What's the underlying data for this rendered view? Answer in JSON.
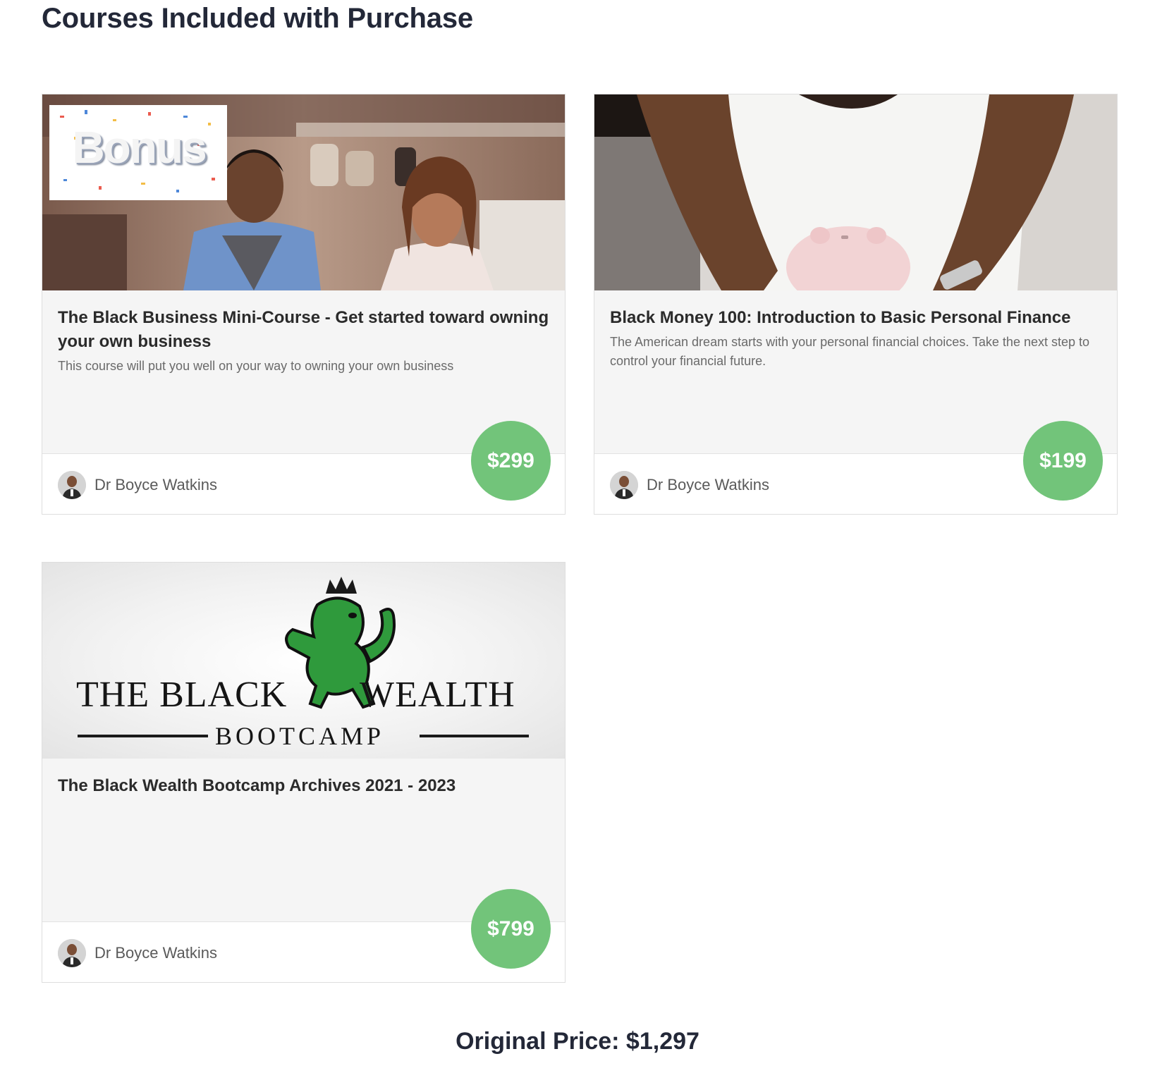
{
  "page": {
    "title": "Courses Included with Purchase",
    "original_price": "Original Price: $1,297"
  },
  "courses": [
    {
      "image_badge": "Bonus",
      "title": "The Black Business Mini-Course - Get started toward owning your own business",
      "description": "This course will put you well on your way to owning your own business",
      "author": "Dr Boyce Watkins",
      "price": "$299"
    },
    {
      "title": "Black Money 100: Introduction to Basic Personal Finance",
      "description": "The American dream starts with your personal financial choices. Take the next step to control your financial future.",
      "author": "Dr Boyce Watkins",
      "price": "$199"
    },
    {
      "image_logo": {
        "line1_left": "THE BLACK",
        "line1_right": "WEALTH",
        "line2": "BOOTCAMP"
      },
      "title": "The Black Wealth Bootcamp Archives 2021 - 2023",
      "description": "",
      "author": "Dr Boyce Watkins",
      "price": "$799"
    }
  ],
  "colors": {
    "price_badge": "#72c47a",
    "card_body": "#f5f5f5",
    "heading": "#232838"
  }
}
